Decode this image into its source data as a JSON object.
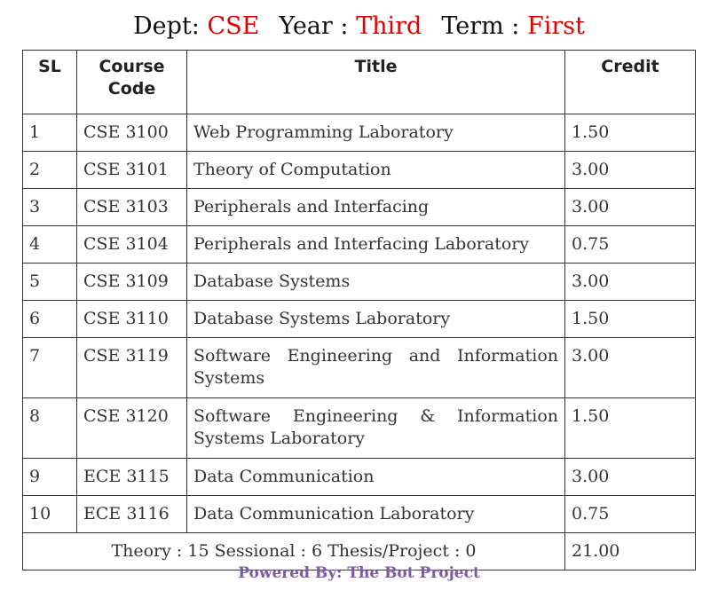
{
  "header": {
    "dept_label": "Dept: ",
    "dept_value": "CSE",
    "year_label": "Year : ",
    "year_value": "Third",
    "term_label": "Term : ",
    "term_value": "First"
  },
  "columns": {
    "sl": "SL",
    "code_line1": "Course",
    "code_line2": "Code",
    "title": "Title",
    "credit": "Credit"
  },
  "rows": [
    {
      "sl": "1",
      "code": "CSE 3100",
      "title": "Web Programming Laboratory",
      "credit": "1.50"
    },
    {
      "sl": "2",
      "code": "CSE 3101",
      "title": "Theory of Computation",
      "credit": "3.00"
    },
    {
      "sl": "3",
      "code": "CSE 3103",
      "title": "Peripherals and Interfacing",
      "credit": "3.00"
    },
    {
      "sl": "4",
      "code": "CSE 3104",
      "title": "Peripherals and Interfacing Laboratory",
      "credit": "0.75"
    },
    {
      "sl": "5",
      "code": "CSE 3109",
      "title": "Database Systems",
      "credit": "3.00"
    },
    {
      "sl": "6",
      "code": "CSE 3110",
      "title": "Database Systems Laboratory",
      "credit": "1.50"
    },
    {
      "sl": "7",
      "code": "CSE 3119",
      "title": "Software Engineering and Information Systems",
      "credit": "3.00"
    },
    {
      "sl": "8",
      "code": "CSE 3120",
      "title": "Software Engineering & Information Systems Laboratory",
      "credit": "1.50"
    },
    {
      "sl": "9",
      "code": "ECE 3115",
      "title": "Data Communication",
      "credit": "3.00"
    },
    {
      "sl": "10",
      "code": "ECE 3116",
      "title": "Data Communication Laboratory",
      "credit": "0.75"
    }
  ],
  "summary": {
    "text": "Theory : 15 Sessional : 6 Thesis/Project : 0",
    "total_credit": "21.00"
  },
  "footer": {
    "text": "Powered By: The Bot Project"
  },
  "colors": {
    "value_red": "#e00000",
    "footer_purple": "#7b5aa6"
  }
}
